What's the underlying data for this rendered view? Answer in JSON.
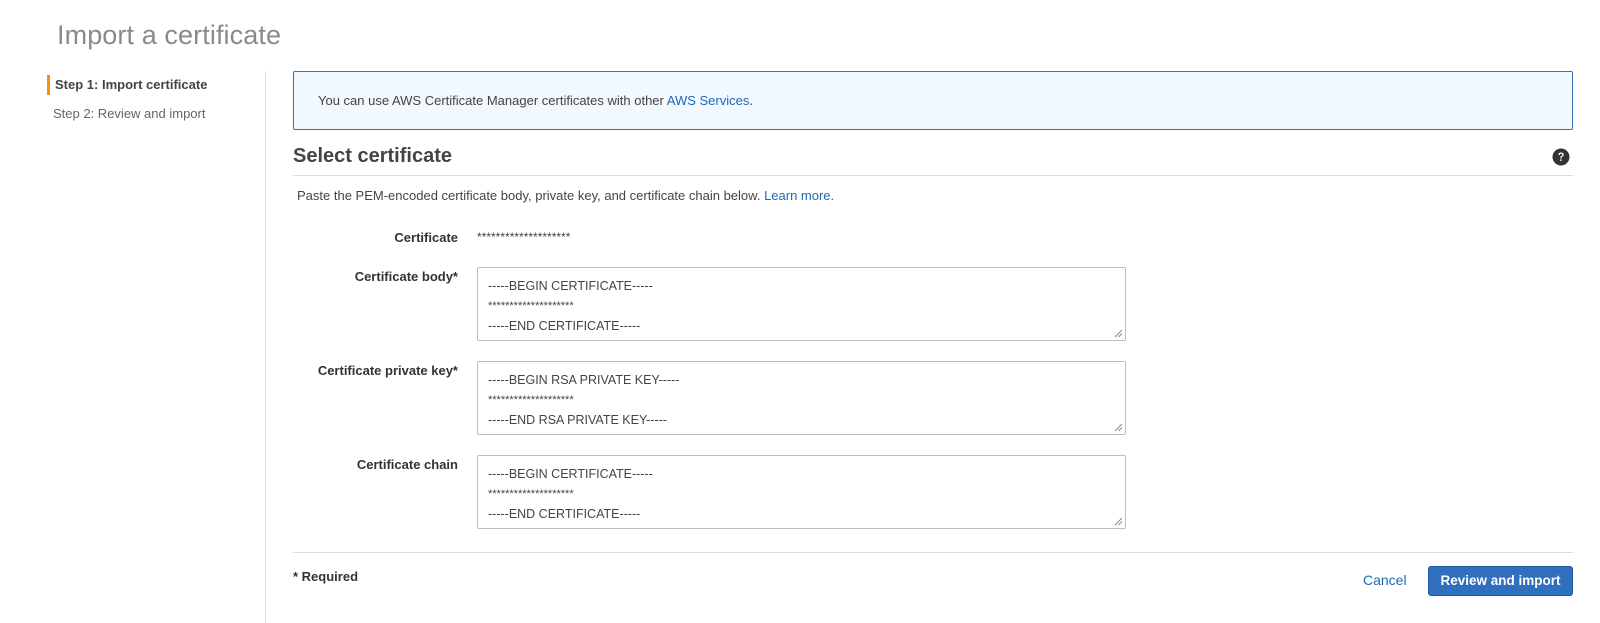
{
  "page": {
    "title": "Import a certificate"
  },
  "steps": [
    {
      "label": "Step 1: Import certificate",
      "active": true
    },
    {
      "label": "Step 2: Review and import",
      "active": false
    }
  ],
  "info": {
    "text": "You can use AWS Certificate Manager certificates with other ",
    "link": "AWS Services",
    "suffix": "."
  },
  "section": {
    "title": "Select certificate",
    "help_icon": "question-circle-icon",
    "description": "Paste the PEM-encoded certificate body, private key, and certificate chain below. ",
    "learn_more": "Learn more."
  },
  "fields": {
    "certificate": {
      "label": "Certificate",
      "value": "********************"
    },
    "body": {
      "label": "Certificate body*",
      "lines": [
        "-----BEGIN CERTIFICATE-----",
        "********************",
        "-----END CERTIFICATE-----"
      ]
    },
    "private_key": {
      "label": "Certificate private key*",
      "lines": [
        "-----BEGIN RSA PRIVATE KEY-----",
        "********************",
        "-----END RSA PRIVATE KEY-----"
      ]
    },
    "chain": {
      "label": "Certificate chain",
      "lines": [
        "-----BEGIN CERTIFICATE-----",
        "********************",
        "-----END CERTIFICATE-----"
      ]
    }
  },
  "footer": {
    "required_note": "* Required",
    "cancel": "Cancel",
    "submit": "Review and import"
  },
  "colors": {
    "accent_orange": "#f0921a",
    "link_blue": "#1d6ab3",
    "primary_button": "#2f6fbd",
    "info_background": "#f1f8fe"
  }
}
